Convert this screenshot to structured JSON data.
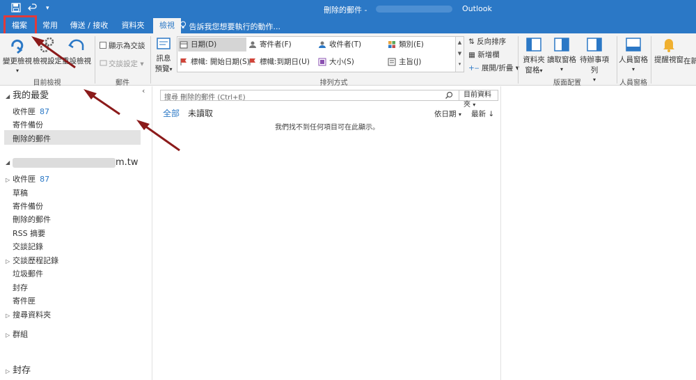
{
  "titlebar": {
    "window_title": "刪除的郵件 -",
    "app_name": "Outlook"
  },
  "tabs": [
    {
      "label": "檔案"
    },
    {
      "label": "常用"
    },
    {
      "label": "傳送 / 接收"
    },
    {
      "label": "資料夾"
    },
    {
      "label": "檢視"
    }
  ],
  "tell_me": "告訴我您想要執行的動作...",
  "ribbon": {
    "current_view": {
      "change_view": "變更檢視",
      "view_settings": "檢視設定",
      "reset_view": "重設檢視",
      "group_label": "目前檢視"
    },
    "messages": {
      "show_as_conversations": "顯示為交談",
      "conversation_settings": "交談設定",
      "group_label": "郵件"
    },
    "arrangement": {
      "message_preview_line1": "訊息",
      "message_preview_line2": "預覽",
      "items": [
        {
          "label": "日期(D)"
        },
        {
          "label": "寄件者(F)"
        },
        {
          "label": "收件者(T)"
        },
        {
          "label": "類別(E)"
        },
        {
          "label": "標幟: 開始日期(S)"
        },
        {
          "label": "標幟:到期日(U)"
        },
        {
          "label": "大小(S)"
        },
        {
          "label": "主旨(J)"
        }
      ],
      "reverse_sort": "反向排序",
      "add_columns": "新增欄",
      "expand_collapse": "展開/折疊",
      "group_label": "排列方式"
    },
    "layout": {
      "folder_pane_line1": "資料夾",
      "folder_pane_line2": "窗格",
      "reading_pane": "讀取窗格",
      "todo_bar": "待辦事項列",
      "group_label": "版面配置"
    },
    "people_pane": {
      "label": "人員窗格",
      "group_label": "人員窗格"
    },
    "reminders_window": "提醒視窗",
    "open_in": "在新"
  },
  "nav": {
    "favorites_header": "我的最愛",
    "favorites": [
      {
        "label": "收件匣",
        "count": "87"
      },
      {
        "label": "寄件備份",
        "count": ""
      },
      {
        "label": "刪除的郵件",
        "count": ""
      }
    ],
    "account_suffix": "m.tw",
    "folders": [
      {
        "label": "收件匣",
        "count": "87"
      },
      {
        "label": "草稿",
        "count": ""
      },
      {
        "label": "寄件備份",
        "count": ""
      },
      {
        "label": "刪除的郵件",
        "count": ""
      },
      {
        "label": "RSS 摘要",
        "count": ""
      },
      {
        "label": "交談記錄",
        "count": ""
      },
      {
        "label": "交談歷程記錄",
        "count": ""
      },
      {
        "label": "垃圾郵件",
        "count": ""
      },
      {
        "label": "封存",
        "count": ""
      },
      {
        "label": "寄件匣",
        "count": ""
      },
      {
        "label": "搜尋資料夾",
        "count": ""
      }
    ],
    "groups": "群組",
    "archive": "封存"
  },
  "list": {
    "search_placeholder": "搜尋 刪除的郵件 (Ctrl+E)",
    "search_scope": "目前資料夾",
    "filter_all": "全部",
    "filter_unread": "未讀取",
    "sort_by": "依日期",
    "sort_order": "最新",
    "empty_message": "我們找不到任何項目可在此顯示。"
  },
  "colors": {
    "accent": "#2b78c6",
    "highlight_box": "#e23a3a",
    "arrow": "#8b1a1a"
  }
}
